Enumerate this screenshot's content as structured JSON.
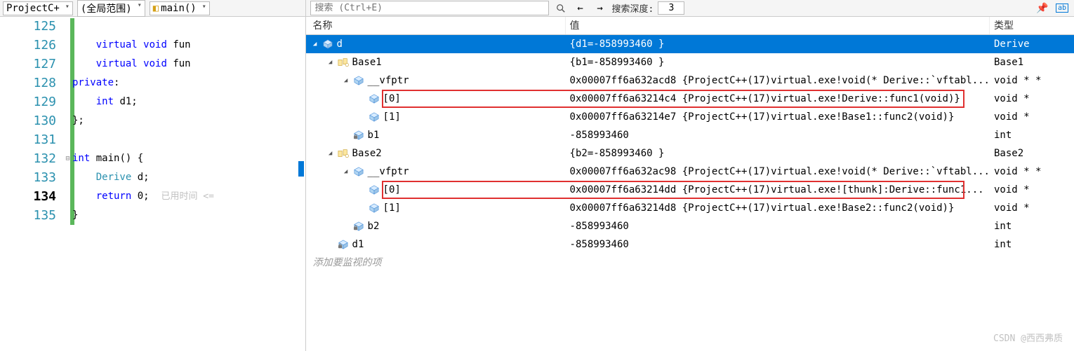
{
  "toolbar": {
    "project_combo": "ProjectC+",
    "scope_combo": "(全局范围)",
    "main_combo": "main()"
  },
  "code": {
    "lines": [
      {
        "n": "125",
        "raw": ""
      },
      {
        "n": "126",
        "raw": "    virtual void fun"
      },
      {
        "n": "127",
        "raw": "    virtual void fun"
      },
      {
        "n": "128",
        "raw": "private:"
      },
      {
        "n": "129",
        "raw": "    int d1;"
      },
      {
        "n": "130",
        "raw": "};"
      },
      {
        "n": "131",
        "raw": ""
      },
      {
        "n": "132",
        "raw": "int main() {"
      },
      {
        "n": "133",
        "raw": "    Derive d;"
      },
      {
        "n": "134",
        "raw": "    return 0;"
      },
      {
        "n": "135",
        "raw": "}"
      }
    ],
    "current_line": "134",
    "time_hint": "已用时间 <="
  },
  "watch_toolbar": {
    "search_placeholder": "搜索 (Ctrl+E)",
    "depth_label": "搜索深度:",
    "depth_value": "3"
  },
  "watch_header": {
    "name": "名称",
    "value": "值",
    "type": "类型"
  },
  "watch_rows": [
    {
      "depth": 0,
      "exp": true,
      "open": true,
      "sel": true,
      "icon": "cube",
      "name": "d",
      "value": "{d1=-858993460 }",
      "type": "Derive"
    },
    {
      "depth": 1,
      "exp": true,
      "open": true,
      "sel": false,
      "icon": "struct",
      "name": "Base1",
      "value": "{b1=-858993460 }",
      "type": "Base1"
    },
    {
      "depth": 2,
      "exp": true,
      "open": true,
      "sel": false,
      "icon": "cube",
      "name": "__vfptr",
      "value": "0x00007ff6a632acd8 {ProjectC++(17)virtual.exe!void(* Derive::`vftabl...",
      "type": "void * *"
    },
    {
      "depth": 3,
      "exp": false,
      "open": false,
      "sel": false,
      "icon": "cube",
      "name": "[0]",
      "value": "0x00007ff6a63214c4 {ProjectC++(17)virtual.exe!Derive::func1(void)}",
      "type": "void *",
      "hl": true
    },
    {
      "depth": 3,
      "exp": false,
      "open": false,
      "sel": false,
      "icon": "cube",
      "name": "[1]",
      "value": "0x00007ff6a63214e7 {ProjectC++(17)virtual.exe!Base1::func2(void)}",
      "type": "void *"
    },
    {
      "depth": 2,
      "exp": false,
      "open": false,
      "sel": false,
      "icon": "lock",
      "name": "b1",
      "value": "-858993460",
      "type": "int"
    },
    {
      "depth": 1,
      "exp": true,
      "open": true,
      "sel": false,
      "icon": "struct",
      "name": "Base2",
      "value": "{b2=-858993460 }",
      "type": "Base2"
    },
    {
      "depth": 2,
      "exp": true,
      "open": true,
      "sel": false,
      "icon": "cube",
      "name": "__vfptr",
      "value": "0x00007ff6a632ac98 {ProjectC++(17)virtual.exe!void(* Derive::`vftabl...",
      "type": "void * *"
    },
    {
      "depth": 3,
      "exp": false,
      "open": false,
      "sel": false,
      "icon": "cube",
      "name": "[0]",
      "value": "0x00007ff6a63214dd {ProjectC++(17)virtual.exe![thunk]:Derive::func1...",
      "type": "void *",
      "hl": true
    },
    {
      "depth": 3,
      "exp": false,
      "open": false,
      "sel": false,
      "icon": "cube",
      "name": "[1]",
      "value": "0x00007ff6a63214d8 {ProjectC++(17)virtual.exe!Base2::func2(void)}",
      "type": "void *"
    },
    {
      "depth": 2,
      "exp": false,
      "open": false,
      "sel": false,
      "icon": "lock",
      "name": "b2",
      "value": "-858993460",
      "type": "int"
    },
    {
      "depth": 1,
      "exp": false,
      "open": false,
      "sel": false,
      "icon": "lock",
      "name": "d1",
      "value": "-858993460",
      "type": "int"
    }
  ],
  "watch_placeholder": "添加要监视的项",
  "watermark": "CSDN @西西弗质"
}
